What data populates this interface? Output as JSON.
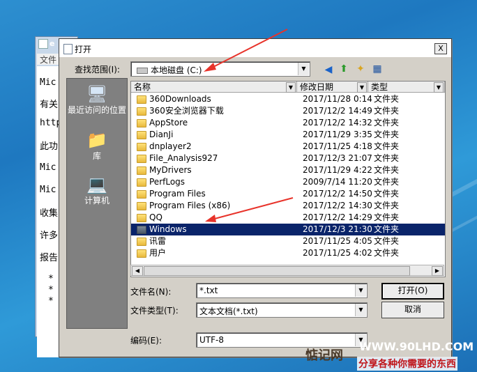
{
  "notepad": {
    "title": "e",
    "menu_file": "文件",
    "lines": [
      "Mic",
      "有关",
      "http",
      "此功",
      "Mic",
      "Mic",
      "收集",
      "许多",
      "报告",
      "*",
      "*",
      "*"
    ]
  },
  "dialog": {
    "title": "打开",
    "close": "X",
    "look_in_label": "查找范围(I):",
    "look_in_value": "本地磁盘 (C:)",
    "places": [
      {
        "label": "最近访问的位置",
        "icon": "recent-places-icon"
      },
      {
        "label": "库",
        "icon": "library-icon"
      },
      {
        "label": "计算机",
        "icon": "computer-icon"
      }
    ],
    "columns": {
      "name": "名称",
      "date": "修改日期",
      "type": "类型"
    },
    "files": [
      {
        "name": "360Downloads",
        "date": "2017/11/28 0:14",
        "type": "文件夹"
      },
      {
        "name": "360安全浏览器下载",
        "date": "2017/12/2 14:49",
        "type": "文件夹"
      },
      {
        "name": "AppStore",
        "date": "2017/12/2 14:32",
        "type": "文件夹"
      },
      {
        "name": "DianJi",
        "date": "2017/11/29 3:35",
        "type": "文件夹"
      },
      {
        "name": "dnplayer2",
        "date": "2017/11/25 4:18",
        "type": "文件夹"
      },
      {
        "name": "File_Analysis927",
        "date": "2017/12/3 21:07",
        "type": "文件夹"
      },
      {
        "name": "MyDrivers",
        "date": "2017/11/29 4:22",
        "type": "文件夹"
      },
      {
        "name": "PerfLogs",
        "date": "2009/7/14 11:20",
        "type": "文件夹"
      },
      {
        "name": "Program Files",
        "date": "2017/12/2 14:50",
        "type": "文件夹"
      },
      {
        "name": "Program Files (x86)",
        "date": "2017/12/2 14:30",
        "type": "文件夹"
      },
      {
        "name": "QQ",
        "date": "2017/12/2 14:29",
        "type": "文件夹"
      },
      {
        "name": "Windows",
        "date": "2017/12/3 21:30",
        "type": "文件夹",
        "selected": true
      },
      {
        "name": "讯雷",
        "date": "2017/11/25 4:05",
        "type": "文件夹"
      },
      {
        "name": "用户",
        "date": "2017/11/25 4:02",
        "type": "文件夹"
      }
    ],
    "filename_label": "文件名(N):",
    "filename_value": "*.txt",
    "filetype_label": "文件类型(T):",
    "filetype_value": "文本文档(*.txt)",
    "encoding_label": "编码(E):",
    "encoding_value": "UTF-8",
    "open_button": "打开(O)",
    "cancel_button": "取消"
  },
  "watermark": {
    "logo": "惦记网",
    "url": "WWW.90LHD.COM",
    "slogan": "分享各种你需要的东西"
  },
  "colors": {
    "selection": "#0a246a",
    "annotation_arrow": "#e8332a"
  }
}
